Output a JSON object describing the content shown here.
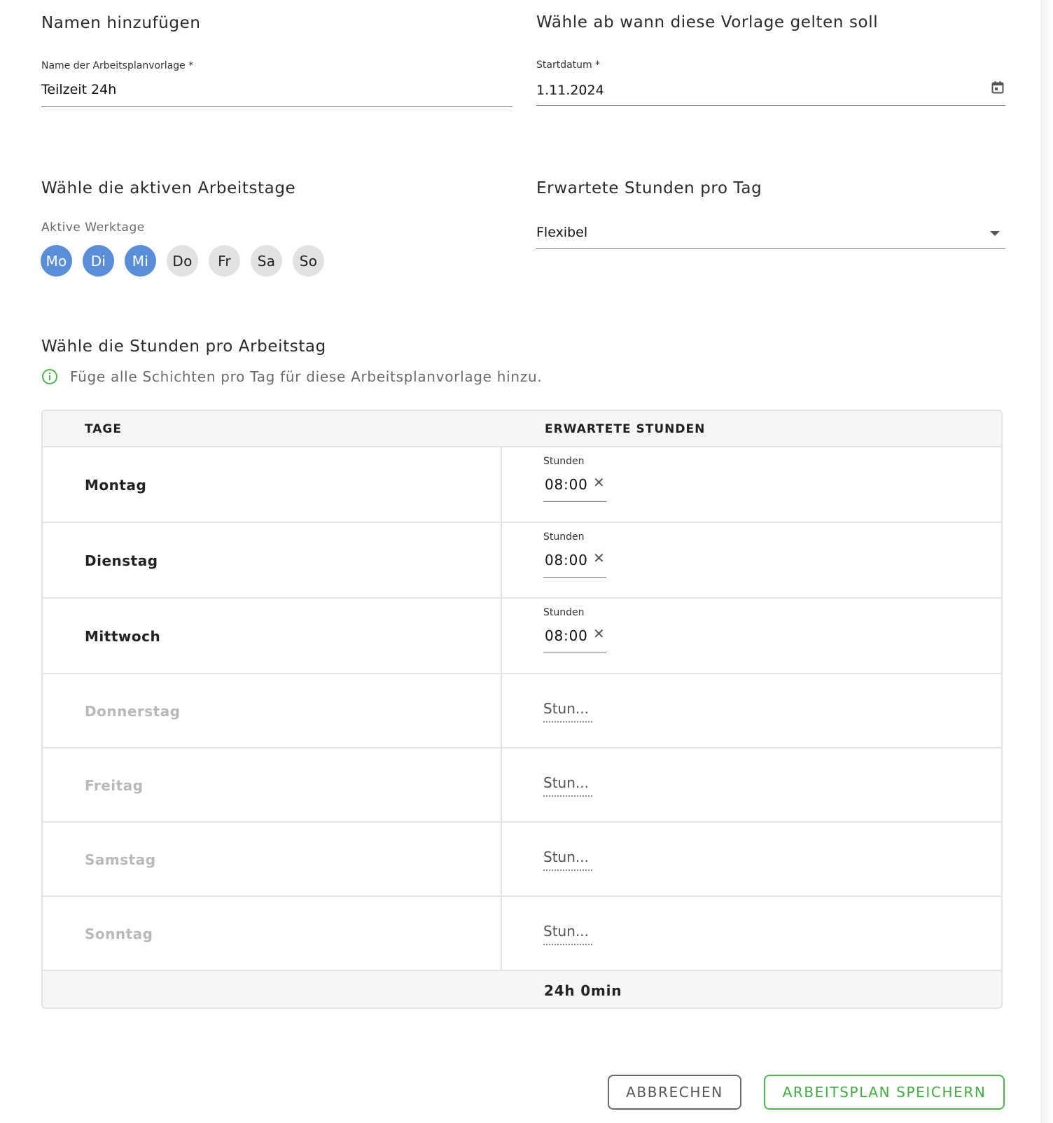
{
  "name_section": {
    "title": "Namen hinzufügen",
    "field_label": "Name der Arbeitsplanvorlage *",
    "value": "Teilzeit 24h"
  },
  "start_section": {
    "title": "Wähle ab wann diese Vorlage gelten soll",
    "field_label": "Startdatum *",
    "value": "1.11.2024",
    "icon": "calendar-icon"
  },
  "workdays_section": {
    "title": "Wähle die aktiven Arbeitstage",
    "sub_label": "Aktive Werktage",
    "days": [
      {
        "label": "Mo",
        "active": true
      },
      {
        "label": "Di",
        "active": true
      },
      {
        "label": "Mi",
        "active": true
      },
      {
        "label": "Do",
        "active": false
      },
      {
        "label": "Fr",
        "active": false
      },
      {
        "label": "Sa",
        "active": false
      },
      {
        "label": "So",
        "active": false
      }
    ]
  },
  "hours_type_section": {
    "title": "Erwartete Stunden pro Tag",
    "selected": "Flexibel"
  },
  "hours_section": {
    "title": "Wähle die Stunden pro Arbeitstag",
    "info": "Füge alle Schichten pro Tag für diese Arbeitsplanvorlage hinzu."
  },
  "table": {
    "col_days": "TAGE",
    "col_hours": "ERWARTETE STUNDEN",
    "rows": [
      {
        "day": "Montag",
        "active": true,
        "hours_label": "Stunden",
        "value": "08:00"
      },
      {
        "day": "Dienstag",
        "active": true,
        "hours_label": "Stunden",
        "value": "08:00"
      },
      {
        "day": "Mittwoch",
        "active": true,
        "hours_label": "Stunden",
        "value": "08:00"
      },
      {
        "day": "Donnerstag",
        "active": false,
        "placeholder": "Stun..."
      },
      {
        "day": "Freitag",
        "active": false,
        "placeholder": "Stun..."
      },
      {
        "day": "Samstag",
        "active": false,
        "placeholder": "Stun..."
      },
      {
        "day": "Sonntag",
        "active": false,
        "placeholder": "Stun..."
      }
    ],
    "total": "24h 0min"
  },
  "buttons": {
    "cancel": "ABBRECHEN",
    "save": "ARBEITSPLAN SPEICHERN"
  },
  "colors": {
    "accent_blue": "#5b8ed9",
    "save_green": "#4cb64c",
    "info_green": "#4cb64c"
  }
}
